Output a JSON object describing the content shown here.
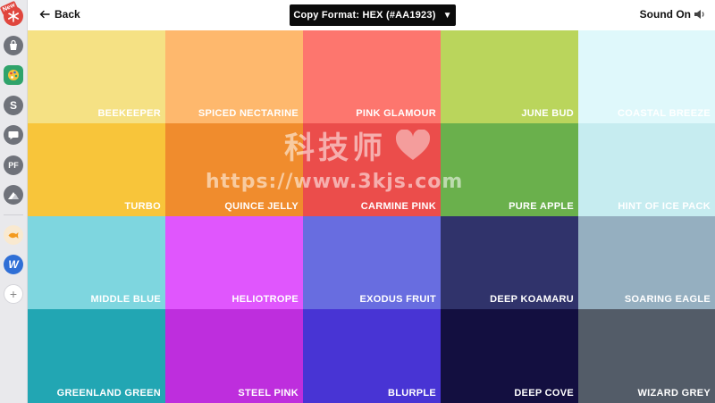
{
  "sidebar": {
    "new_badge": "New",
    "items": [
      {
        "icon": "snowflake-icon",
        "color": "#e0463d"
      },
      {
        "icon": "bag-icon",
        "color": "#6f727a"
      },
      {
        "icon": "palette-icon",
        "color": "#2fa36b"
      },
      {
        "icon": "s-icon",
        "label": "S",
        "color": "#6f727a"
      },
      {
        "icon": "chat-icon",
        "color": "#6f727a"
      },
      {
        "icon": "pf-icon",
        "label": "PF",
        "color": "#6f727a"
      },
      {
        "icon": "mountain-icon",
        "color": "#6f727a"
      },
      {
        "icon": "fish-icon",
        "color": "#f39a1e"
      },
      {
        "icon": "w-icon",
        "label": "W",
        "color": "#2f6fd6"
      },
      {
        "icon": "plus-icon",
        "label": "+",
        "color": "#e9e9ec"
      }
    ]
  },
  "header": {
    "back_label": "Back",
    "copy_format_label": "Copy Format: HEX (#AA1923)",
    "sound_label": "Sound On"
  },
  "swatches": [
    {
      "name": "BEEKEEPER",
      "color": "#f5e184"
    },
    {
      "name": "SPICED NECTARINE",
      "color": "#feb86d"
    },
    {
      "name": "PINK GLAMOUR",
      "color": "#fd766e"
    },
    {
      "name": "JUNE BUD",
      "color": "#bad55c"
    },
    {
      "name": "COASTAL BREEZE",
      "color": "#dff8fb"
    },
    {
      "name": "TURBO",
      "color": "#f8c53a"
    },
    {
      "name": "QUINCE JELLY",
      "color": "#f08c2d"
    },
    {
      "name": "CARMINE PINK",
      "color": "#eb4d4b"
    },
    {
      "name": "PURE APPLE",
      "color": "#6ab04c"
    },
    {
      "name": "HINT OF ICE PACK",
      "color": "#c6ecf0"
    },
    {
      "name": "MIDDLE BLUE",
      "color": "#7ed6df"
    },
    {
      "name": "HELIOTROPE",
      "color": "#e056fd"
    },
    {
      "name": "EXODUS FRUIT",
      "color": "#686de0"
    },
    {
      "name": "DEEP KOAMARU",
      "color": "#30336b"
    },
    {
      "name": "SOARING EAGLE",
      "color": "#95afc0"
    },
    {
      "name": "GREENLAND GREEN",
      "color": "#22a6b3"
    },
    {
      "name": "STEEL PINK",
      "color": "#be2edd"
    },
    {
      "name": "BLURPLE",
      "color": "#4834d4"
    },
    {
      "name": "DEEP COVE",
      "color": "#130f40"
    },
    {
      "name": "WIZARD GREY",
      "color": "#535c68"
    }
  ],
  "watermark": {
    "cn_text": "科技师",
    "url": "https://www.3kjs.com"
  }
}
